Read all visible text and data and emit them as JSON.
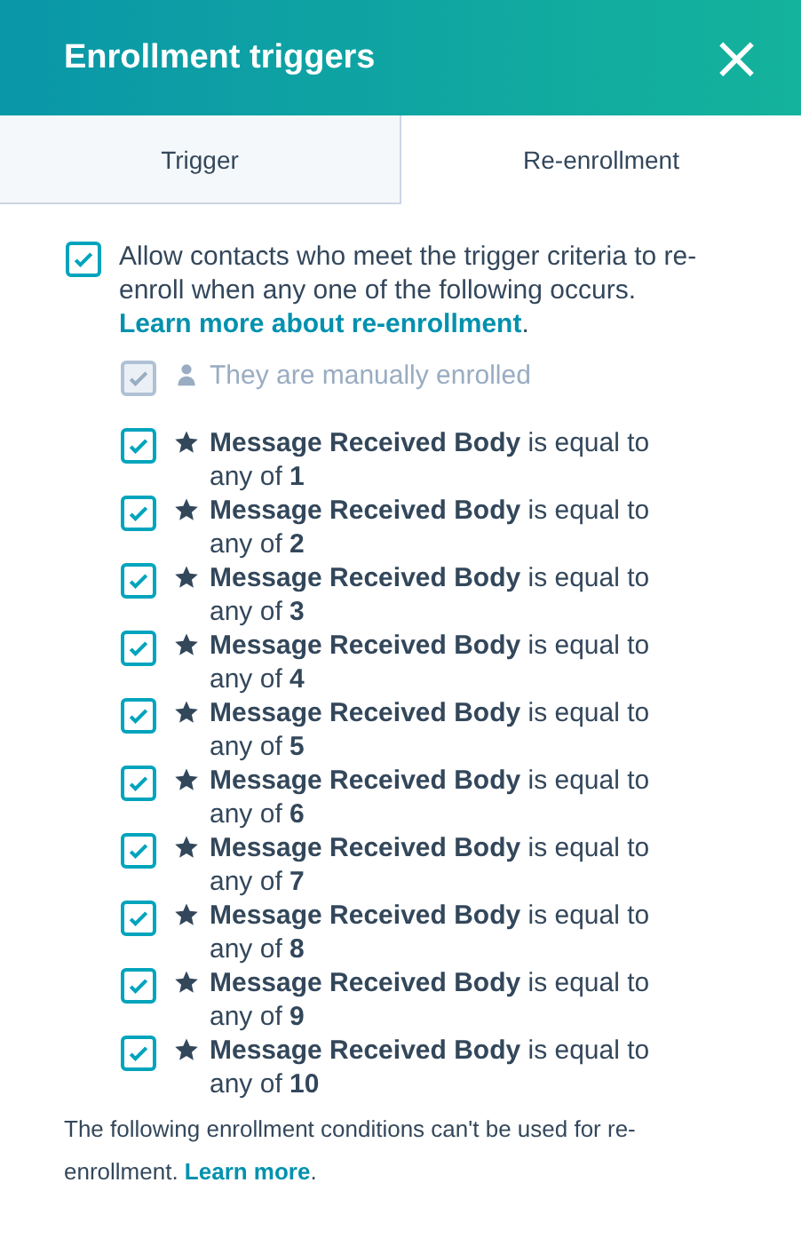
{
  "header": {
    "title": "Enrollment triggers",
    "close": "×"
  },
  "tabs": [
    {
      "label": "Trigger",
      "selected": false
    },
    {
      "label": "Re-enrollment",
      "selected": true
    }
  ],
  "allow": {
    "checked": true,
    "text": "Allow contacts who meet the trigger criteria to re-enroll when any one of the following occurs.",
    "link": "Learn more about re-enrollment",
    "after": "."
  },
  "items": [
    {
      "kind": "manual",
      "checked": true,
      "disabled": true,
      "text": "They are manually enrolled"
    },
    {
      "kind": "property",
      "checked": true,
      "disabled": false,
      "text": "**Message Received Body** is equal to any of **1**"
    },
    {
      "kind": "property",
      "checked": true,
      "disabled": false,
      "text": "**Message Received Body** is equal to any of **2**"
    },
    {
      "kind": "property",
      "checked": true,
      "disabled": false,
      "text": "**Message Received Body** is equal to any of **3**"
    },
    {
      "kind": "property",
      "checked": true,
      "disabled": false,
      "text": "**Message Received Body** is equal to any of **4**"
    },
    {
      "kind": "property",
      "checked": true,
      "disabled": false,
      "text": "**Message Received Body** is equal to any of **5**"
    },
    {
      "kind": "property",
      "checked": true,
      "disabled": false,
      "text": "**Message Received Body** is equal to any of **6**"
    },
    {
      "kind": "property",
      "checked": true,
      "disabled": false,
      "text": "**Message Received Body** is equal to any of **7**"
    },
    {
      "kind": "property",
      "checked": true,
      "disabled": false,
      "text": "**Message Received Body** is equal to any of **8**"
    },
    {
      "kind": "property",
      "checked": true,
      "disabled": false,
      "text": "**Message Received Body** is equal to any of **9**"
    },
    {
      "kind": "property",
      "checked": true,
      "disabled": false,
      "text": "**Message Received Body** is equal to any of **10**"
    }
  ],
  "footer": {
    "text": "The following enrollment conditions can't be used for re-enrollment.",
    "link": "Learn more",
    "after": "."
  }
}
